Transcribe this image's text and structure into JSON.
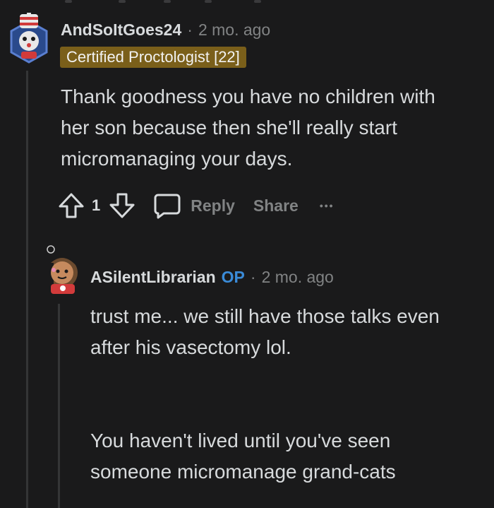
{
  "comment1": {
    "username": "AndSoItGoes24",
    "separator": "·",
    "time": "2 mo. ago",
    "flair": "Certified Proctologist [22]",
    "body_lines": [
      "Thank goodness you have no children with",
      "her son because then she'll really start",
      "micromanaging your days."
    ],
    "votes": "1",
    "reply_label": "Reply",
    "share_label": "Share",
    "more_label": "•••"
  },
  "comment2": {
    "username": "ASilentLibrarian",
    "op_label": "OP",
    "separator": "·",
    "time": "2 mo. ago",
    "body_lines": [
      "trust me... we still have those talks even",
      "after his vasectomy lol.",
      "",
      "",
      "You haven't lived until you've seen",
      "someone micromanage grand-cats"
    ]
  },
  "colors": {
    "background": "#1a1a1b",
    "text": "#d7dadc",
    "muted": "#818384",
    "flair_bg": "#7a5f1a",
    "op": "#3a8bd8",
    "thread_line": "#343536"
  },
  "icons": [
    "upvote-icon",
    "downvote-icon",
    "comment-icon",
    "more-icon"
  ]
}
